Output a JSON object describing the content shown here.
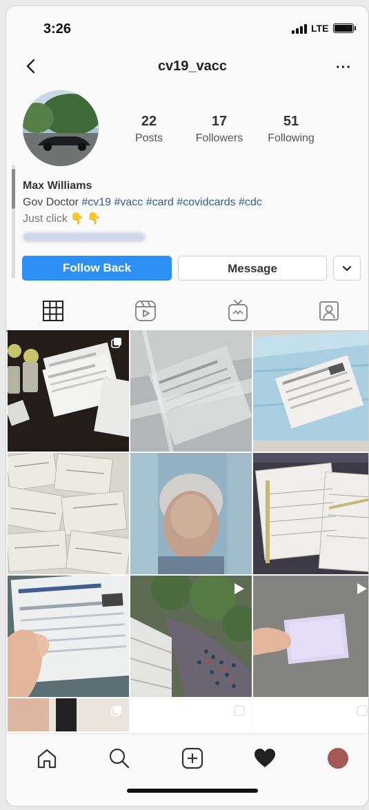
{
  "status_bar": {
    "time": "3:26",
    "network": "LTE"
  },
  "header": {
    "username": "cv19_vacc",
    "more_label": "···"
  },
  "profile": {
    "stats": [
      {
        "value": "22",
        "label": "Posts"
      },
      {
        "value": "17",
        "label": "Followers"
      },
      {
        "value": "51",
        "label": "Following"
      }
    ],
    "name": "Max Williams",
    "bio_prefix": "Gov Doctor ",
    "bio_hashtags": "#cv19 #vacc #card #covidcards #cdc",
    "bio_line2": "Just click 👇 👇"
  },
  "actions": {
    "follow_label": "Follow Back",
    "message_label": "Message"
  },
  "tabs": [
    "grid-icon",
    "reels-icon",
    "igtv-icon",
    "tagged-icon"
  ],
  "bottom_nav": [
    "home-icon",
    "search-icon",
    "new-post-icon",
    "activity-heart-icon",
    "profile-avatar"
  ],
  "colors": {
    "accent": "#2e90f5",
    "hashtag": "#315b94"
  }
}
